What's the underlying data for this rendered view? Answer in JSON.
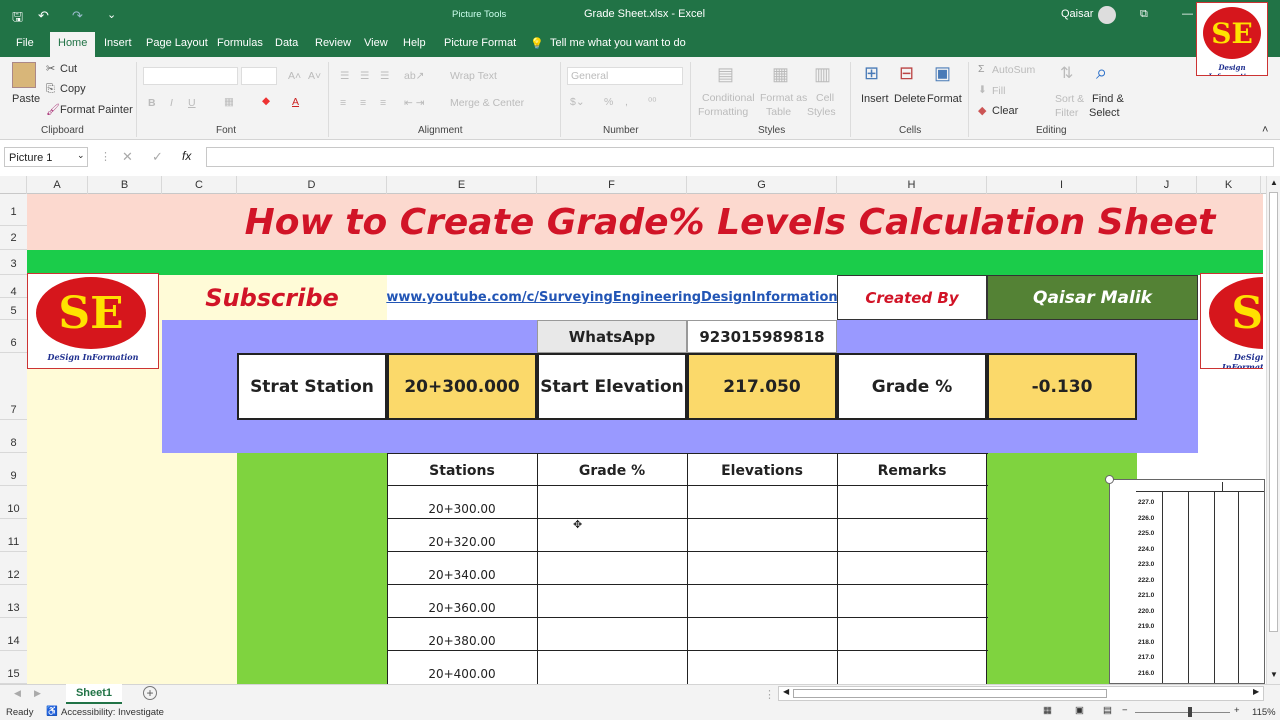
{
  "titlebar": {
    "picture_tools": "Picture Tools",
    "filename": "Grade Sheet.xlsx  -  Excel",
    "user": "Qaisar"
  },
  "menu": [
    "File",
    "Home",
    "Insert",
    "Page Layout",
    "Formulas",
    "Data",
    "Review",
    "View",
    "Help",
    "Picture Format"
  ],
  "tell_me": "Tell me what you want to do",
  "ribbon": {
    "clipboard": {
      "paste": "Paste",
      "cut": "Cut",
      "copy": "Copy",
      "format_painter": "Format Painter",
      "label": "Clipboard"
    },
    "font_label": "Font",
    "alignment": {
      "wrap": "Wrap Text",
      "merge": "Merge & Center",
      "label": "Alignment"
    },
    "number": {
      "format": "General",
      "label": "Number"
    },
    "styles": {
      "conditional": "Conditional",
      "formatting": "Formatting",
      "format_as": "Format as",
      "table": "Table",
      "cell": "Cell",
      "cell_styles": "Styles",
      "label": "Styles"
    },
    "cells": {
      "insert": "Insert",
      "delete": "Delete",
      "format": "Format",
      "label": "Cells"
    },
    "editing": {
      "autosum": "AutoSum",
      "fill": "Fill",
      "clear": "Clear",
      "sort": "Sort &",
      "filter": "Filter",
      "find": "Find &",
      "select": "Select",
      "label": "Editing"
    }
  },
  "formula_bar": {
    "name_box": "Picture 1",
    "fx": "fx"
  },
  "columns": [
    "A",
    "B",
    "C",
    "D",
    "E",
    "F",
    "G",
    "H",
    "I",
    "J",
    "K"
  ],
  "rows": [
    "1",
    "2",
    "3",
    "4",
    "5",
    "6",
    "7",
    "8",
    "9",
    "10",
    "11",
    "12",
    "13",
    "14",
    "15"
  ],
  "sheet": {
    "title": "How to Create Grade%  Levels Calculation Sheet",
    "subscribe": "Subscribe",
    "youtube": "www.youtube.com/c/SurveyingEngineeringDesignInformation",
    "created_by": "Created By",
    "author": "Qaisar Malik",
    "whatsapp_label": "WhatsApp",
    "whatsapp": "923015989818",
    "start_station_label": "Strat Station",
    "start_station": "20+300.000",
    "start_elev_label": "Start Elevation",
    "start_elev": "217.050",
    "grade_label": "Grade %",
    "grade": "-0.130",
    "table_headers": [
      "Stations",
      "Grade %",
      "Elevations",
      "Remarks"
    ],
    "stations": [
      "20+300.00",
      "20+320.00",
      "20+340.00",
      "20+360.00",
      "20+380.00",
      "20+400.00"
    ],
    "logo_text": "SE",
    "logo_sub": "DeSign InFormation",
    "chart_ticks": [
      "227.0",
      "226.0",
      "225.0",
      "224.0",
      "223.0",
      "222.0",
      "221.0",
      "220.0",
      "219.0",
      "218.0",
      "217.0",
      "216.0"
    ]
  },
  "corner_logo": {
    "text": "SE",
    "sub": "Design Information"
  },
  "sheet_tab": "Sheet1",
  "status": {
    "ready": "Ready",
    "accessibility": "Accessibility: Investigate",
    "zoom": "115%"
  }
}
